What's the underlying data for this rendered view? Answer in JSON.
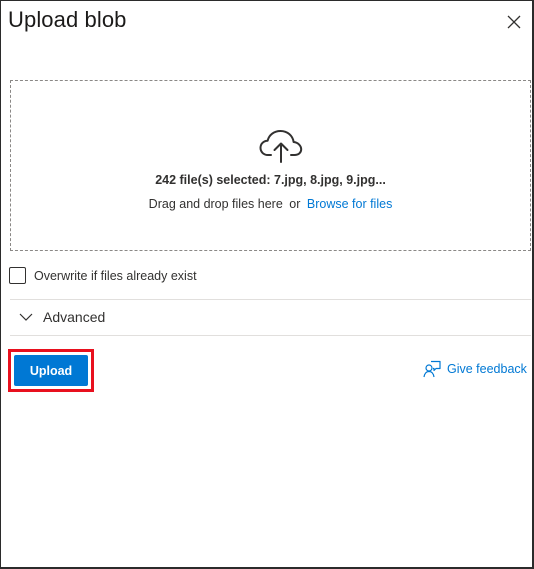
{
  "panel": {
    "title": "Upload blob",
    "close_icon": "close-icon"
  },
  "dropzone": {
    "icon": "cloud-upload-icon",
    "selected_text": "242 file(s) selected: 7.jpg, 8.jpg, 9.jpg...",
    "drag_text": "Drag and drop files here",
    "or_text": "or",
    "browse_label": "Browse for files"
  },
  "overwrite": {
    "label": "Overwrite if files already exist",
    "checked": false
  },
  "advanced": {
    "label": "Advanced",
    "icon": "chevron-down-icon",
    "expanded": false
  },
  "actions": {
    "upload_label": "Upload",
    "feedback_label": "Give feedback",
    "feedback_icon": "feedback-icon"
  },
  "colors": {
    "accent": "#0078d4",
    "highlight": "#e8101e"
  }
}
